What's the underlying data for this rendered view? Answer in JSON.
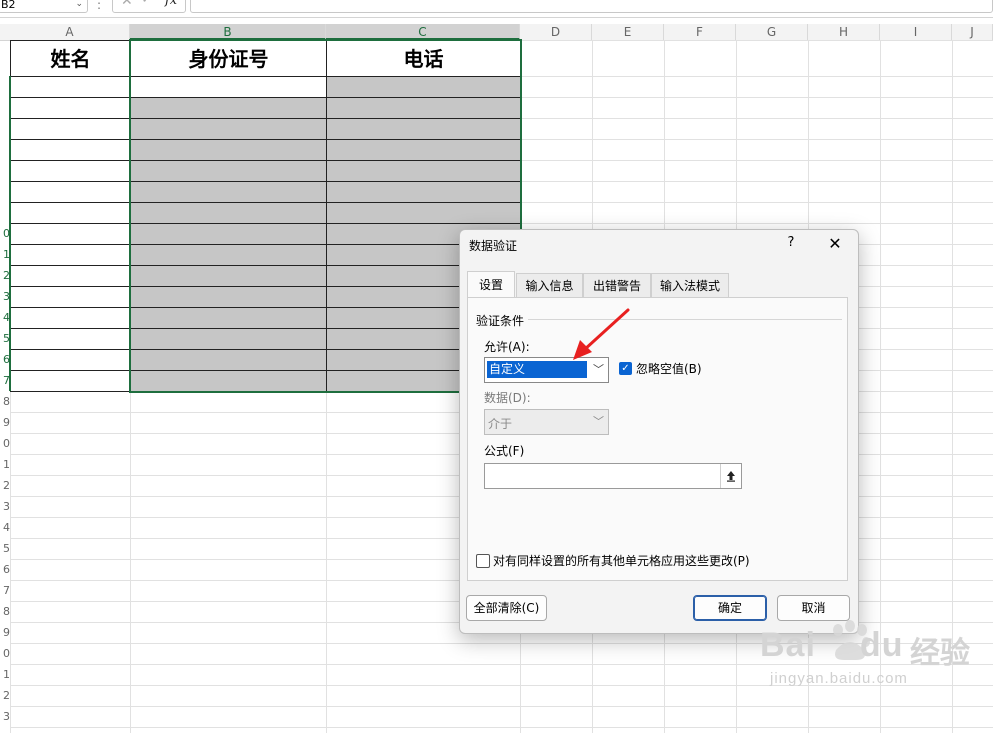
{
  "formula_bar": {
    "name_box": "B2",
    "separator": ":",
    "fx_label": "fx",
    "formula": ""
  },
  "columns": [
    "A",
    "B",
    "C",
    "D",
    "E",
    "F",
    "G",
    "H",
    "I",
    "J"
  ],
  "row_numbers": [
    "",
    "",
    "",
    "",
    "",
    "",
    "",
    "",
    "0",
    "1",
    "2",
    "3",
    "4",
    "5",
    "6",
    "7",
    "8",
    "9",
    "0",
    "1",
    "2",
    "3",
    "4",
    "5",
    "6",
    "7",
    "8",
    "9",
    "0",
    "1",
    "2",
    "3"
  ],
  "table": {
    "headers": [
      "姓名",
      "身份证号",
      "电话"
    ]
  },
  "dialog": {
    "title": "数据验证",
    "help": "?",
    "close": "✕",
    "tabs": [
      "设置",
      "输入信息",
      "出错警告",
      "输入法模式"
    ],
    "active_tab": "设置",
    "criteria_label": "验证条件",
    "allow_label": "允许(A):",
    "allow_value": "自定义",
    "ignore_blank_label": "忽略空值(B)",
    "ignore_blank_checked": true,
    "data_label": "数据(D):",
    "data_value": "介于",
    "formula_label": "公式(F)",
    "formula_value": "",
    "apply_all_label": "对有同样设置的所有其他单元格应用这些更改(P)",
    "apply_all_checked": false,
    "clear_all_button": "全部清除(C)",
    "ok_button": "确定",
    "cancel_button": "取消"
  },
  "watermark": {
    "brand": "Bai",
    "brand_du": "du",
    "brand_cn": "经验",
    "url": "jingyan.baidu.com"
  },
  "colors": {
    "accent_green": "#1e6e3e",
    "selection_blue": "#0a64d2",
    "annotation_red": "#e82020",
    "grey_cell": "#c6c6c6"
  }
}
